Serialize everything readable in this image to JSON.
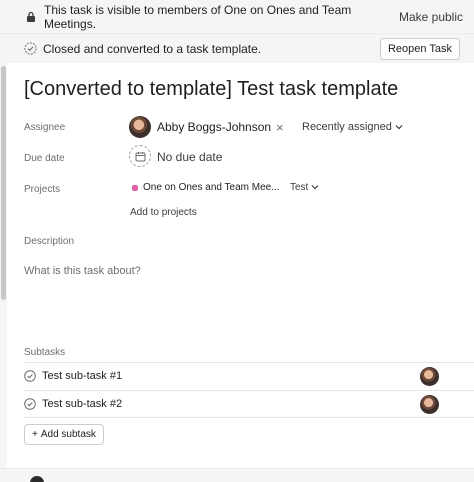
{
  "visibility_banner": {
    "text": "This task is visible to members of One on Ones and Team Meetings.",
    "action": "Make public"
  },
  "closed_banner": {
    "text": "Closed and converted to a task template.",
    "action": "Reopen Task"
  },
  "task": {
    "title": "[Converted to template] Test task template"
  },
  "fields": {
    "assignee_label": "Assignee",
    "assignee_name": "Abby Boggs-Johnson",
    "remove_symbol": "×",
    "recently_assigned": "Recently assigned",
    "due_date_label": "Due date",
    "due_date_value": "No due date",
    "projects_label": "Projects",
    "project_name": "One on Ones and Team Mee...",
    "project_section": "Test",
    "project_color": "#e362a6",
    "add_to_projects": "Add to projects",
    "description_label": "Description",
    "description_placeholder": "What is this task about?"
  },
  "subtasks": {
    "label": "Subtasks",
    "items": [
      {
        "title": "Test sub-task #1"
      },
      {
        "title": "Test sub-task #2"
      }
    ],
    "add_label": "Add subtask",
    "add_symbol": "+"
  },
  "icons": {
    "lock": "lock-icon",
    "check": "check-circle-icon",
    "calendar": "calendar-icon",
    "chevron": "chevron-down-icon"
  }
}
